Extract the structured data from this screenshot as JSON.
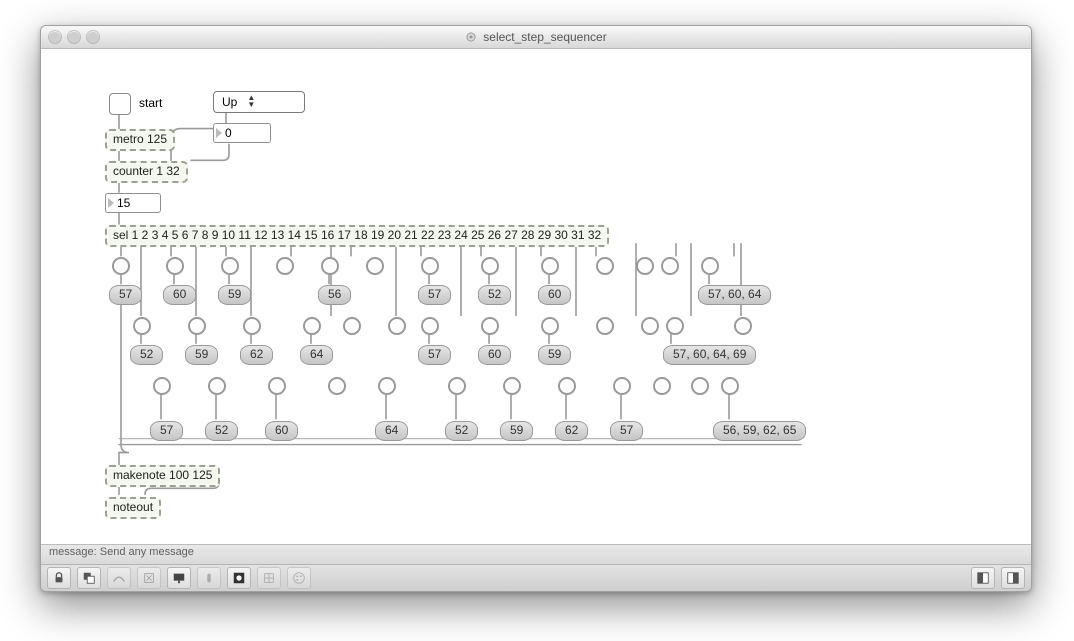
{
  "window": {
    "title": "select_step_sequencer"
  },
  "labels": {
    "start": "start"
  },
  "umenu": {
    "selected": "Up"
  },
  "numbers": {
    "phase": "0",
    "current": "15"
  },
  "objects": {
    "metro": "metro 125",
    "counter": "counter 1 32",
    "sel": "sel 1 2 3 4 5 6 7 8 9 10 11 12 13 14 15 16 17 18 19 20 21 22 23 24 25 26 27 28 29 30 31 32",
    "makenote": "makenote 100 125",
    "noteout": "noteout"
  },
  "rows": {
    "r1": [
      "57",
      "60",
      "59",
      "56",
      "57",
      "52",
      "60",
      "57, 60, 64"
    ],
    "r2": [
      "52",
      "59",
      "62",
      "64",
      "57",
      "60",
      "59",
      "57, 60, 64, 69"
    ],
    "r3": [
      "57",
      "52",
      "60",
      "64",
      "52",
      "59",
      "62",
      "57",
      "56, 59, 62, 65"
    ]
  },
  "hint": "message: Send any message"
}
